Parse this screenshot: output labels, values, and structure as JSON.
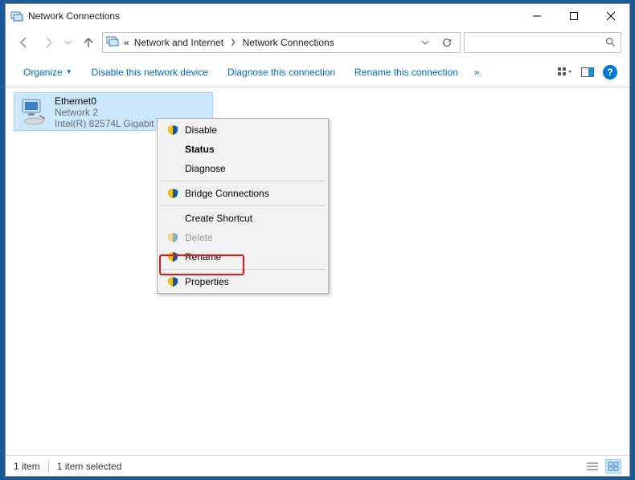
{
  "window": {
    "title": "Network Connections"
  },
  "address": {
    "parent": "Network and Internet",
    "current": "Network Connections"
  },
  "search": {
    "placeholder": ""
  },
  "toolbar": {
    "organize": "Organize",
    "disable": "Disable this network device",
    "diagnose": "Diagnose this connection",
    "rename": "Rename this connection",
    "overflow": "»"
  },
  "connection": {
    "name": "Ethernet0",
    "network": "Network 2",
    "adapter": "Intel(R) 82574L Gigabit"
  },
  "contextMenu": {
    "disable": "Disable",
    "status": "Status",
    "diagnose": "Diagnose",
    "bridge": "Bridge Connections",
    "shortcut": "Create Shortcut",
    "delete": "Delete",
    "rename": "Rename",
    "properties": "Properties"
  },
  "statusbar": {
    "count": "1 item",
    "selected": "1 item selected"
  }
}
